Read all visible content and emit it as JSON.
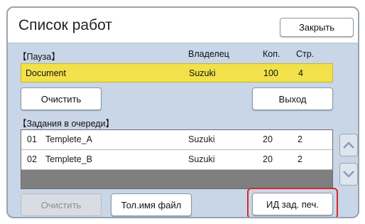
{
  "window": {
    "title": "Список работ",
    "close_label": "Закрыть"
  },
  "paused": {
    "section_label": "【Пауза】",
    "columns": {
      "owner": "Владелец",
      "copies": "Коп.",
      "pages": "Стр."
    },
    "job": {
      "name": "Document",
      "owner": "Suzuki",
      "copies": "100",
      "pages": "4"
    },
    "clear_label": "Очистить",
    "exit_label": "Выход"
  },
  "queue": {
    "section_label": "【Задания в очереди】",
    "jobs": [
      {
        "num": "01",
        "name": "Templete_A",
        "owner": "Suzuki",
        "copies": "20",
        "pages": "2"
      },
      {
        "num": "02",
        "name": "Templete_B",
        "owner": "Suzuki",
        "copies": "20",
        "pages": "2"
      }
    ],
    "scroll_up_icon": "chevron-up-icon",
    "scroll_down_icon": "chevron-down-icon"
  },
  "footer": {
    "clear_label": "Очистить",
    "filename_label": "Тол.имя файл",
    "print_id_label": "ИД зад. печ."
  },
  "colors": {
    "panel": "#c9d6e8",
    "paused_row": "#f2e14a",
    "highlight": "#d42a2a"
  }
}
